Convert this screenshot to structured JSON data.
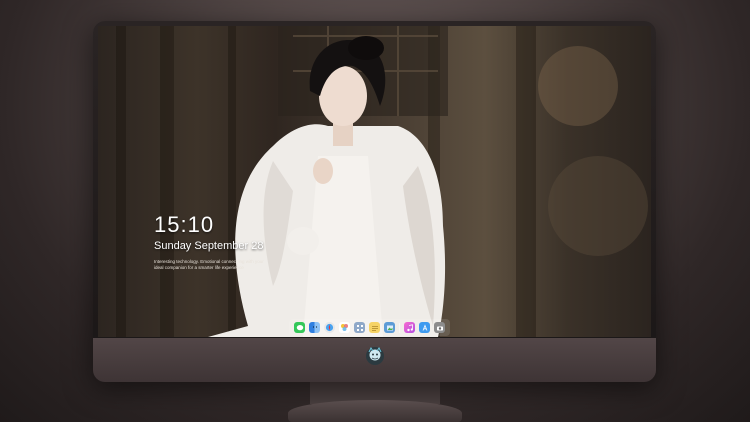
{
  "lock_screen": {
    "time": "15:10",
    "date": "Sunday September 28",
    "tagline": "Interesting technology. Emotional connect ing with your ideal companion for a smarter life experience"
  },
  "dock": {
    "items": [
      {
        "icon": "messages-icon",
        "color": "#34c759"
      },
      {
        "icon": "finder-icon",
        "color": "#2f7fe0"
      },
      {
        "icon": "safari-icon",
        "color": "#e8e8e8"
      },
      {
        "icon": "photos-icon",
        "color": "#f3c43a"
      },
      {
        "icon": "launchpad-icon",
        "color": "#8fa8c8"
      },
      {
        "icon": "notes-icon",
        "color": "#f6d365"
      },
      {
        "icon": "preview-icon",
        "color": "#5c9bd6"
      },
      {
        "icon": "music-icon",
        "color": "#e25ad0"
      },
      {
        "icon": "app-store-icon",
        "color": "#3f9bf0"
      },
      {
        "icon": "camera-icon",
        "color": "#8c8c8c"
      }
    ]
  },
  "colors": {
    "frame": "#1a1616",
    "chin": "#4a3f40",
    "background": "#3f3535"
  }
}
